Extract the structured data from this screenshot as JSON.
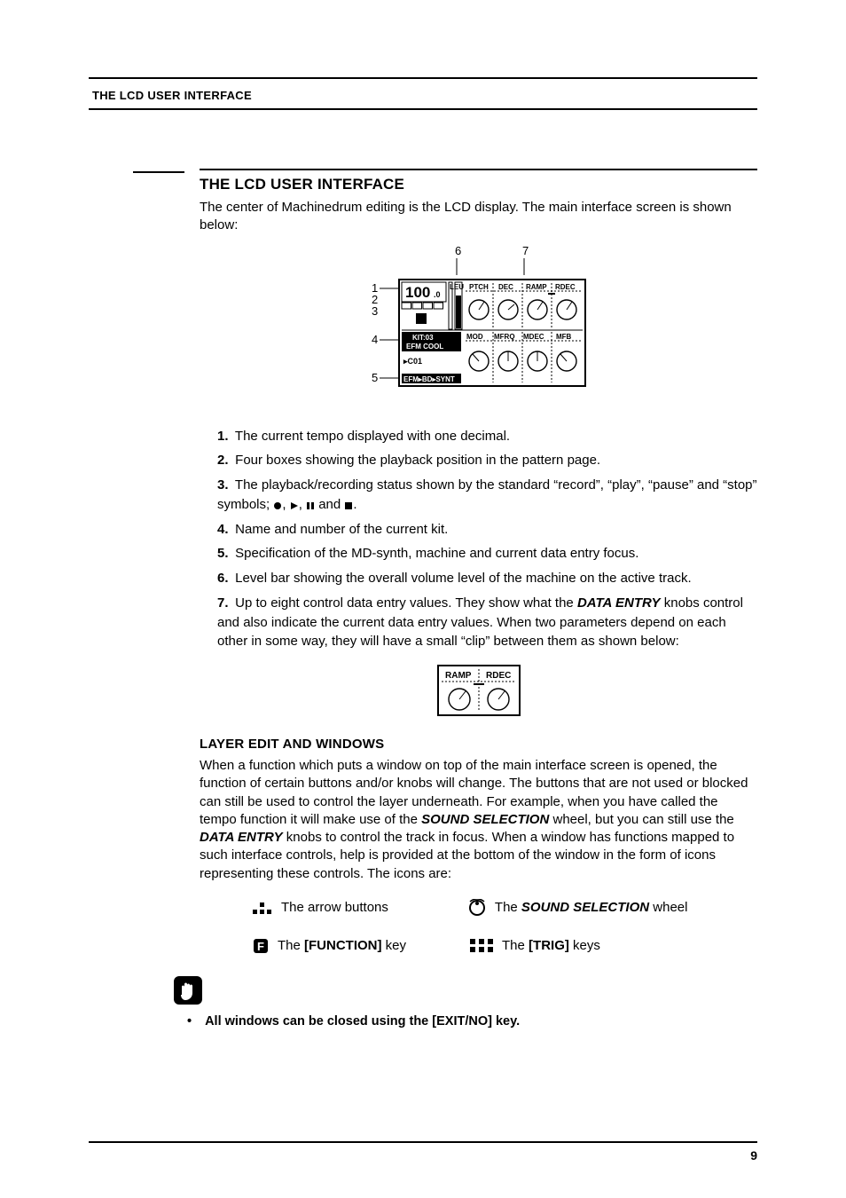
{
  "running_head": "THE LCD USER INTERFACE",
  "section_title": "THE LCD USER INTERFACE",
  "intro": "The center of Machinedrum editing is the LCD display. The main interface screen is shown below:",
  "callouts": {
    "c1": "1",
    "c2": "2",
    "c3": "3",
    "c4": "4",
    "c5": "5",
    "c6": "6",
    "c7": "7"
  },
  "lcd": {
    "tempo": "100",
    "tempo_dec": ".0",
    "row1": {
      "a": "LEU",
      "b": "PTCH",
      "c": "DEC",
      "d": "RAMP",
      "e": "RDEC"
    },
    "row2": {
      "a": "MOD",
      "b": "MFRQ",
      "c": "MDEC",
      "d": "MFB"
    },
    "kit_line1": "KIT:03",
    "kit_line2": "EFM COOL",
    "seq_line": "▸C01",
    "synth_line": "EFM▸BD▸SYNT"
  },
  "list": {
    "i1": "The current tempo displayed with one decimal.",
    "i2": "Four boxes showing the playback position in the pattern page.",
    "i3a": "The playback/recording status shown by the standard “record”, “play”, “pause” and “stop” symbols; ",
    "i3b": " and ",
    "i3c": ".",
    "i4": "Name and number of the current kit.",
    "i5": "Specification of the MD-synth, machine and current data entry focus.",
    "i6": "Level bar showing the overall volume level of the machine on the active track.",
    "i7a": "Up to eight control data entry values. They show what the ",
    "i7b": " knobs control and also indicate the current data entry values. When two parameters depend on each other in some way, they will have a small “clip” between them as shown below:",
    "data_entry": "DATA ENTRY"
  },
  "small_lcd": {
    "a": "RAMP",
    "b": "RDEC"
  },
  "sub_title": "LAYER EDIT AND WINDOWS",
  "layer_para_a": "When a function which puts a window on top of the main interface screen is opened, the function of certain buttons and/or knobs will change. The buttons that are not used or blocked can still be used to control the layer underneath. For example, when you have called the tempo function it will make use of the ",
  "layer_para_b": " wheel, but you can still use the ",
  "layer_para_c": " knobs to control the track in focus. When a window has func­tions mapped to such interface controls, help is provided at the bottom of the window in the form of icons representing these controls. The icons are:",
  "sound_selection": "SOUND SELECTION",
  "icons": {
    "arrows": "The arrow buttons",
    "wheel_a": "The ",
    "wheel_b": " wheel",
    "func_a": "The ",
    "func_b": " key",
    "function": "[FUNCTION]",
    "trig_a": "The ",
    "trig_b": " keys",
    "trig": "[TRIG]"
  },
  "note": "All windows can be closed using the [EXIT/NO] key.",
  "page_number": "9"
}
